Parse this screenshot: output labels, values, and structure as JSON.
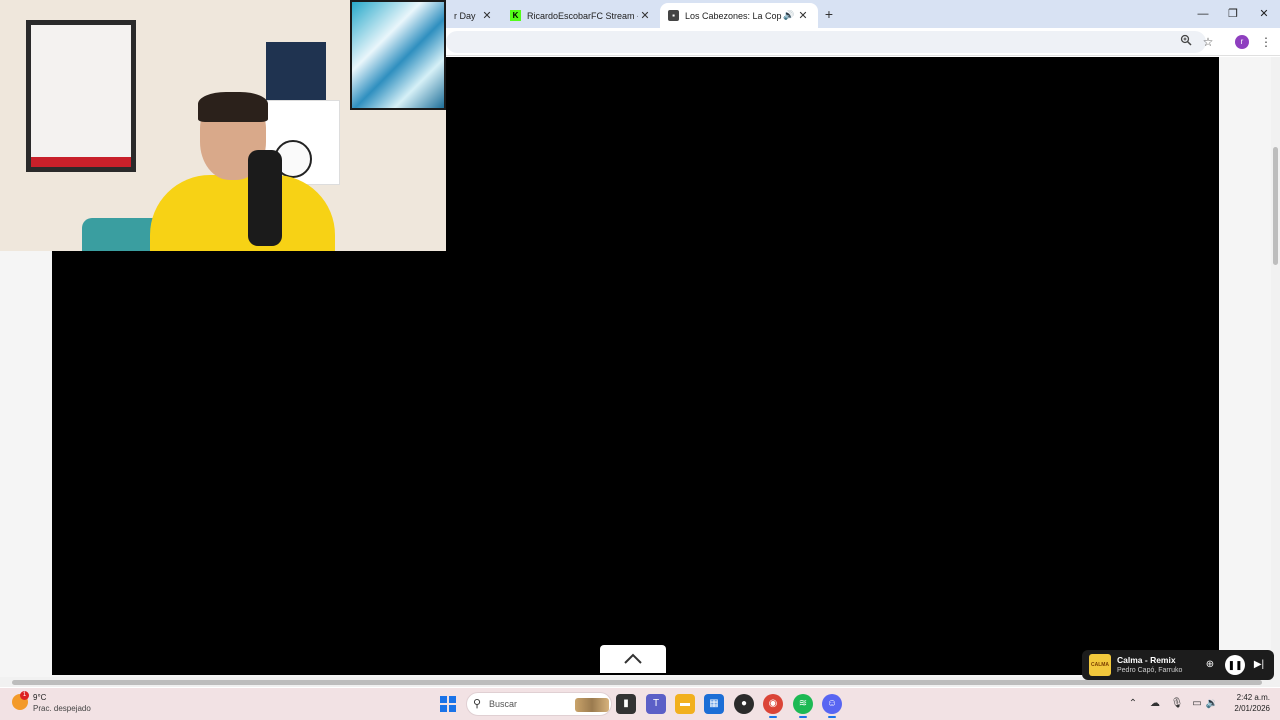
{
  "browser": {
    "tabs": [
      {
        "title": "r Day",
        "favicon": "tab-favicon",
        "active": false
      },
      {
        "title": "RicardoEscobarFC Stream - Wa",
        "favicon": "kick-logo-icon",
        "active": false
      },
      {
        "title": "Los Cabezones: La Copa Mu",
        "favicon": "page-icon",
        "active": true,
        "muted_indicator": "speaker-icon"
      }
    ],
    "new_tab_glyph": "+",
    "window_controls": [
      "minimize-icon",
      "restore-icon",
      "close-icon"
    ],
    "toolbar_icons": [
      "zoom-icon",
      "star-icon",
      "profile-avatar",
      "menu-icon"
    ],
    "profile_initial": "r"
  },
  "page": {
    "collapse_button_icon": "chevron-up-icon"
  },
  "mini_player": {
    "album_art_text": "CALMA",
    "title": "Calma - Remix",
    "artist": "Pedro Capó, Farruko",
    "buttons": [
      "add-icon",
      "pause-icon",
      "next-icon"
    ]
  },
  "taskbar": {
    "weather": {
      "badge": "1",
      "temperature": "9°C",
      "description": "Prac. despejado"
    },
    "search_placeholder": "Buscar",
    "apps": [
      {
        "name": "start-menu",
        "color": "#1a73e8"
      },
      {
        "name": "file-manager",
        "color": "#333333"
      },
      {
        "name": "teams",
        "color": "#5b5fc7"
      },
      {
        "name": "file-explorer",
        "color": "#f2b01e"
      },
      {
        "name": "ms-store",
        "color": "#1c6ed6"
      },
      {
        "name": "game-app",
        "color": "#2b2b2b"
      },
      {
        "name": "chrome",
        "color": "#db4437"
      },
      {
        "name": "spotify",
        "color": "#1db954"
      },
      {
        "name": "discord",
        "color": "#5865f2"
      }
    ],
    "clock": {
      "time": "2:42 a.m.",
      "date": "2/01/2026"
    }
  }
}
